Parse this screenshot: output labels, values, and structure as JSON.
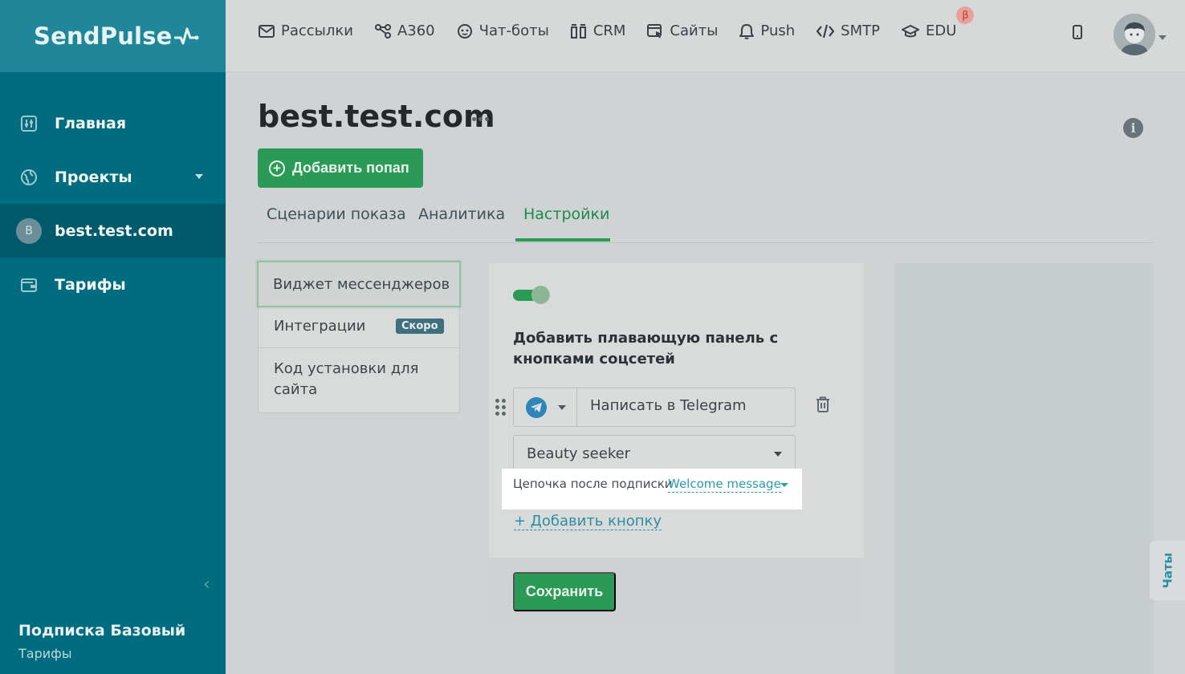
{
  "brand": {
    "name": "SendPulse"
  },
  "topnav": [
    {
      "label": "Рассылки",
      "icon": "envelope-icon"
    },
    {
      "label": "A360",
      "icon": "flow-icon"
    },
    {
      "label": "Чат-боты",
      "icon": "chat-bot-icon"
    },
    {
      "label": "CRM",
      "icon": "crm-icon"
    },
    {
      "label": "Сайты",
      "icon": "site-icon"
    },
    {
      "label": "Push",
      "icon": "bell-icon"
    },
    {
      "label": "SMTP",
      "icon": "code-icon"
    },
    {
      "label": "EDU",
      "icon": "graduation-cap-icon",
      "badge": "β"
    }
  ],
  "sidebar": {
    "items": [
      {
        "label": "Главная",
        "icon": "dashboard-icon"
      },
      {
        "label": "Проекты",
        "icon": "globe-icon"
      },
      {
        "label": "best.test.com",
        "avatar": "B"
      },
      {
        "label": "Тарифы",
        "icon": "wallet-icon"
      }
    ],
    "plan_title": "Подписка Базовый",
    "plan_link": "Тарифы"
  },
  "page": {
    "title": "best.test.com",
    "add_popup": "Добавить попап",
    "tabs": [
      "Сценарии показа",
      "Аналитика",
      "Настройки"
    ],
    "active_tab": "Настройки"
  },
  "settings_menu": {
    "items": [
      "Виджет мессенджеров",
      "Интеграции",
      "Код установки для сайта"
    ],
    "soon_badge": "Скоро"
  },
  "widget": {
    "enabled": true,
    "heading": "Добавить плавающую панель с кнопками соцсетей",
    "button_text_value": "Написать в Telegram",
    "messenger": "telegram-icon",
    "bot_value": "Beauty seeker",
    "chain_label": "Цепочка после подписки",
    "chain_value": "Welcome message",
    "add_button": "+ Добавить кнопку",
    "save": "Сохранить"
  },
  "chats_tab": "Чаты",
  "colors": {
    "sidebar": "#006c80",
    "accent": "#2a9a56",
    "link": "#2b9bb0"
  }
}
